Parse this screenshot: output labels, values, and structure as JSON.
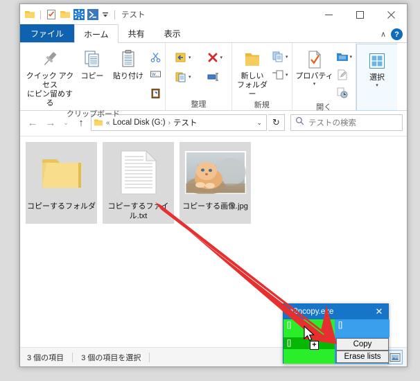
{
  "explorer": {
    "title": "テスト",
    "quick_access": [
      {
        "name": "folder-icon",
        "label": "フォルダー"
      },
      {
        "name": "properties-icon",
        "label": "プロパティ"
      },
      {
        "name": "new-folder-icon",
        "label": "新しいフォルダー"
      },
      {
        "name": "settings-gear-icon",
        "label": "設定"
      },
      {
        "name": "powershell-icon",
        "label": "PowerShell"
      },
      {
        "name": "customize-caret-icon",
        "label": "▾"
      }
    ],
    "window_controls": {
      "minimize": "—",
      "maximize": "□",
      "close": "✕"
    },
    "tabs": [
      {
        "label": "ファイル",
        "type": "file"
      },
      {
        "label": "ホーム",
        "type": "active"
      },
      {
        "label": "共有",
        "type": "normal"
      },
      {
        "label": "表示",
        "type": "normal"
      }
    ],
    "ribbon_collapse": "∧",
    "help_label": "?",
    "ribbon": {
      "groups": [
        {
          "label": "クリップボード",
          "big_buttons": [
            {
              "name": "pin-to-quick-access-button",
              "label": "クイック アクセス\nにピン留めする",
              "line1": "クイック アクセス",
              "line2": "にピン留めする"
            },
            {
              "name": "copy-button",
              "label": "コピー",
              "line1": "コピー",
              "line2": ""
            },
            {
              "name": "paste-button",
              "label": "貼り付け",
              "line1": "貼り付け",
              "line2": ""
            }
          ],
          "small_buttons": [
            {
              "name": "cut-button",
              "label": "切り取り"
            },
            {
              "name": "copy-path-button",
              "label": "パスのコピー"
            },
            {
              "name": "paste-shortcut-button",
              "label": "ショートカットの貼り付け"
            }
          ]
        },
        {
          "label": "整理",
          "small_buttons": [
            {
              "name": "move-to-button",
              "label": "移動先"
            },
            {
              "name": "delete-button",
              "label": "削除"
            },
            {
              "name": "copy-to-button",
              "label": "コピー先"
            },
            {
              "name": "rename-button",
              "label": "名前の変更"
            }
          ]
        },
        {
          "label": "新規",
          "big_buttons": [
            {
              "name": "new-folder-button",
              "line1": "新しい",
              "line2": "フォルダー"
            }
          ],
          "small_buttons": [
            {
              "name": "new-item-button",
              "label": "新しいアイテム"
            },
            {
              "name": "easy-access-button",
              "label": "簡単にアクセス"
            }
          ]
        },
        {
          "label": "開く",
          "big_buttons": [
            {
              "name": "properties-button",
              "line1": "プロパティ",
              "line2": ""
            }
          ],
          "small_buttons": [
            {
              "name": "open-button",
              "label": "開く"
            },
            {
              "name": "edit-button",
              "label": "編集"
            },
            {
              "name": "history-button",
              "label": "履歴"
            }
          ]
        },
        {
          "label": "",
          "big_buttons": [
            {
              "name": "select-button",
              "line1": "選択",
              "line2": ""
            }
          ]
        }
      ]
    },
    "navigation": {
      "back": "←",
      "forward": "→",
      "recent": "⌄",
      "up": "↑",
      "breadcrumb_overflow": "«",
      "breadcrumb": [
        "Local Disk (G:)",
        "テスト"
      ],
      "breadcrumb_separator": "›",
      "address_dropdown": "⌄",
      "refresh": "↻"
    },
    "search": {
      "placeholder": "テストの検索",
      "icon": "search-icon"
    },
    "items": [
      {
        "name": "コピーするフォルダ",
        "type": "folder",
        "selected": true
      },
      {
        "name": "コピーするファイル.txt",
        "type": "text-file",
        "selected": true
      },
      {
        "name": "コピーする画像.jpg",
        "type": "image-file",
        "selected": true
      }
    ],
    "status": {
      "item_count": "3 個の項目",
      "selection_count": "3 個の項目を選択"
    },
    "view_buttons": [
      {
        "name": "details-view-button",
        "active": false
      },
      {
        "name": "large-icons-view-button",
        "active": true
      }
    ]
  },
  "n2ncopy": {
    "title": "n2ncopy.exe",
    "close_label": "✕",
    "cells": {
      "left_top": "[]",
      "left_mid": "[]",
      "left_bot": "",
      "right_top": "[]"
    },
    "buttons": [
      {
        "name": "copy-button",
        "label": "Copy"
      },
      {
        "name": "erase-lists-button",
        "label": "Erase lists"
      }
    ],
    "drag_badge": "+",
    "colors": {
      "title_bar": "#1675c8",
      "green_bright": "#2aee2a",
      "green_dark": "#06b806",
      "blue_panel": "#3aa0ee"
    }
  },
  "annotation": {
    "arrow_color": "#e63030",
    "description": "red-drag-arrow"
  }
}
